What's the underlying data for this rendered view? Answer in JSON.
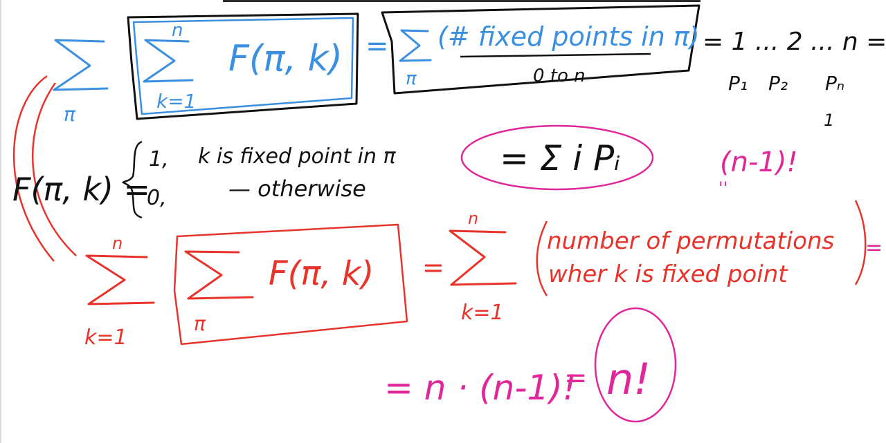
{
  "colors": {
    "blue": "#3a8fe0",
    "black": "#111111",
    "red": "#e8332a",
    "magenta": "#e0279a",
    "background": "#ffffff"
  },
  "row1": {
    "outer_sum_index": "π",
    "inner_sum_upper": "n",
    "inner_sum_lower": "k=1",
    "inner_term": "F(π, k)",
    "equals": "=",
    "rhs_sum_index": "π",
    "rhs_term": "(# fixed points in π)",
    "rhs_range": "0 to n",
    "seq_first": "= 1 ... 2 ... n =",
    "p_labels": [
      "P₁",
      "P₂",
      "Pₙ"
    ],
    "p_n_below": "1"
  },
  "magenta_sum": "= Σ i Pᵢ",
  "magenta_factorial": "(n-1)!",
  "magenta_factorial_tick": "''",
  "indicator": {
    "lhs": "F(π, k) =",
    "case1_value": "1,",
    "case1_text": "k is fixed point in π",
    "case2_value": "0,",
    "case2_text": "— otherwise"
  },
  "row3": {
    "outer_sum_upper": "n",
    "outer_sum_lower": "k=1",
    "inner_sum_index": "π",
    "inner_term": "F(π, k)",
    "equals": "=",
    "rhs_sum_upper": "n",
    "rhs_sum_lower": "k=1",
    "rhs_text_line1": "number of permutations",
    "rhs_text_line2": "wher k is fixed point",
    "trail": "="
  },
  "final": {
    "expr1": "= n · (n-1)!",
    "equals": "=",
    "expr2": "n!"
  }
}
